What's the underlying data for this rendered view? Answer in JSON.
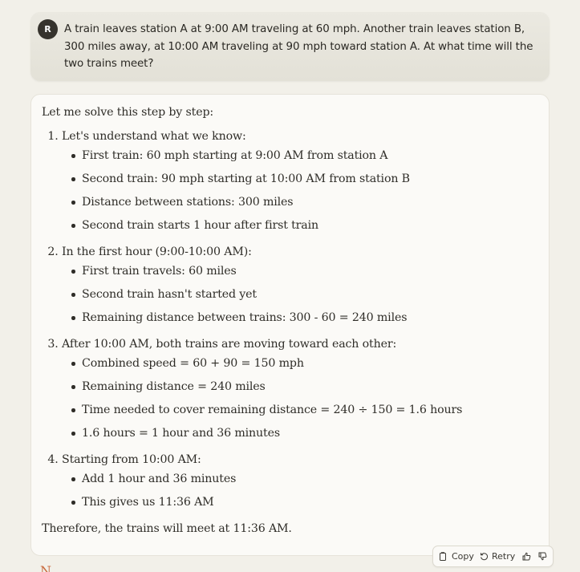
{
  "user_message": {
    "avatar_initial": "R",
    "text": "A train leaves station A at 9:00 AM traveling at 60 mph. Another train leaves station B, 300 miles away, at 10:00 AM traveling at 90 mph toward station A. At what time will the two trains meet?"
  },
  "response": {
    "intro": "Let me solve this step by step:",
    "steps": [
      {
        "heading": "Let's understand what we know:",
        "bullets": [
          "First train: 60 mph starting at 9:00 AM from station A",
          "Second train: 90 mph starting at 10:00 AM from station B",
          "Distance between stations: 300 miles",
          "Second train starts 1 hour after first train"
        ]
      },
      {
        "heading": "In the first hour (9:00-10:00 AM):",
        "bullets": [
          "First train travels: 60 miles",
          "Second train hasn't started yet",
          "Remaining distance between trains: 300 - 60 = 240 miles"
        ]
      },
      {
        "heading": "After 10:00 AM, both trains are moving toward each other:",
        "bullets": [
          "Combined speed = 60 + 90 = 150 mph",
          "Remaining distance = 240 miles",
          "Time needed to cover remaining distance = 240 ÷ 150 = 1.6 hours",
          "1.6 hours = 1 hour and 36 minutes"
        ]
      },
      {
        "heading": "Starting from 10:00 AM:",
        "bullets": [
          "Add 1 hour and 36 minutes",
          "This gives us 11:36 AM"
        ]
      }
    ],
    "conclusion": "Therefore, the trains will meet at 11:36 AM."
  },
  "actions": {
    "copy_label": "Copy",
    "retry_label": "Retry",
    "copy_icon": "clipboard-icon",
    "retry_icon": "retry-arrow-icon",
    "thumbs_up_icon": "thumbs-up-icon",
    "thumbs_down_icon": "thumbs-down-icon"
  },
  "colors": {
    "page_background": "#f2f0e9",
    "user_bubble": "#e7e5dc",
    "avatar": "#36332d",
    "response_card": "#fbfaf7",
    "accent": "#c96b3f"
  }
}
